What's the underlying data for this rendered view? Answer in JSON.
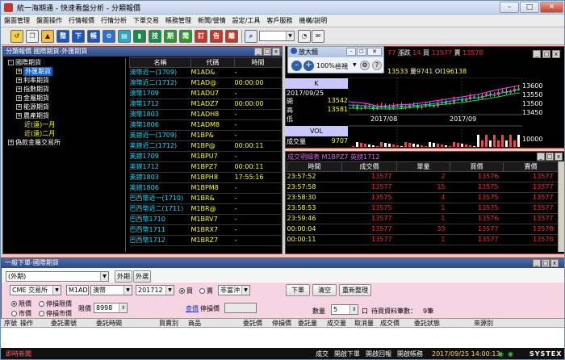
{
  "window": {
    "title": "統一海期通 - 快速看盤分析 - 分類報價"
  },
  "menu": [
    "盤面管理",
    "盤面操作",
    "行情報價",
    "行情分析",
    "下單交易",
    "帳務管理",
    "新聞/營情",
    "設定/工具",
    "客戶服務",
    "機構/說明"
  ],
  "toolbar_icons": [
    "key-icon",
    "new-icon",
    "chart-icon",
    "rise-icon",
    "arrow-down-icon",
    "ticker-icon",
    "gear-icon",
    "analysis-icon",
    "tech-icon",
    "period-icon",
    "news-icon",
    "order-icon",
    "announce-icon",
    "alert-icon",
    "search-icon",
    "chat-icon",
    "message-icon"
  ],
  "toolbar_text": {
    "b1": "整",
    "b2": "下",
    "b3": "帳",
    "b4": "技",
    "b5": "期",
    "b6": "聞",
    "b7": "訂",
    "b8": "告",
    "b9": "離"
  },
  "classpanel": {
    "title": "分類報價 國際期貨-外匯期貨",
    "tree": [
      {
        "label": "國際期貨",
        "level": 0,
        "open": true
      },
      {
        "label": "外匯期貨",
        "level": 1,
        "selected": true
      },
      {
        "label": "利率期貨",
        "level": 1
      },
      {
        "label": "指數期貨",
        "level": 1
      },
      {
        "label": "金屬期貨",
        "level": 1
      },
      {
        "label": "能源期貨",
        "level": 1
      },
      {
        "label": "農產期貨",
        "level": 1
      },
      {
        "label": "近(遠)一月",
        "level": 2
      },
      {
        "label": "近(遠)二月",
        "level": 2
      },
      {
        "label": "偽款金屬交易所",
        "level": 0
      }
    ],
    "columns": [
      "名稱",
      "代碼",
      "時間"
    ],
    "rows": [
      [
        "澳幣近一(1709)",
        "M1AD&",
        "-"
      ],
      [
        "澳幣近二(1712)",
        "M1AD@",
        "00:00:00"
      ],
      [
        "澳幣1709",
        "M1ADU7",
        "-"
      ],
      [
        "澳幣1712",
        "M1ADZ7",
        "00:00:00"
      ],
      [
        "澳幣1803",
        "M1ADH8",
        "-"
      ],
      [
        "澳幣1806",
        "M1ADM8",
        "-"
      ],
      [
        "英鎊近一(1709)",
        "M1BP&",
        "-"
      ],
      [
        "英鎊近二(1712)",
        "M1BP@",
        "00:00:11"
      ],
      [
        "英鎊1709",
        "M1BPU7",
        "-"
      ],
      [
        "英鎊1712",
        "M1BPZ7",
        "00:00:11"
      ],
      [
        "英鎊1803",
        "M1BPH8",
        "17:55:16"
      ],
      [
        "英鎊1806",
        "M1BPM8",
        "-"
      ],
      [
        "巴西幣近一(1710)",
        "M1BR&",
        "-"
      ],
      [
        "巴西幣近二(1711)",
        "M1BR@",
        "-"
      ],
      [
        "巴西幣1710",
        "M1BRV7",
        "-"
      ],
      [
        "巴西幣1711",
        "M1BRX7",
        "-"
      ],
      [
        "巴西幣1712",
        "M1BRZ7",
        "-"
      ]
    ]
  },
  "chart": {
    "quote": {
      "price": "77",
      "chg_label": "漲跌",
      "chg": "14",
      "buy_label": "買",
      "buy": "13577",
      "sell_label": "賣",
      "sell": "13578",
      "line2_a": "13533",
      "vol_label": "量",
      "vol": "9741",
      "oi_label": "OI",
      "oi": "196138"
    },
    "zoom": {
      "title": "放大鏡",
      "percent": "100%",
      "mode": "檢視"
    },
    "k_label": "K",
    "date": "2017/09/25",
    "rows": [
      {
        "label": "開",
        "value": "13542"
      },
      {
        "label": "高",
        "value": "13581"
      },
      {
        "label": "低",
        "value": ""
      }
    ],
    "vol_label": "VOL",
    "vol_row": {
      "label": "成交量",
      "value": "9707"
    },
    "axis": [
      "13600",
      "13550",
      "13500",
      "13450"
    ],
    "vol_axis": "10000",
    "dates": [
      "2017/08",
      "2017/09"
    ]
  },
  "trades": {
    "title": "成交明細表 M1BPZ7 英鎊1712",
    "columns": [
      "時間",
      "成交價",
      "單量",
      "買價",
      "賣價"
    ],
    "rows": [
      [
        "23:57:52",
        "13577",
        "2",
        "13576",
        "13577"
      ],
      [
        "23:57:58",
        "13577",
        "15",
        "13575",
        "13577"
      ],
      [
        "23:58:30",
        "13575",
        "4",
        "13575",
        "13577"
      ],
      [
        "23:58:53",
        "13575",
        "1",
        "13575",
        "13577"
      ],
      [
        "23:59:46",
        "13577",
        "1",
        "13576",
        "13577"
      ],
      [
        "00:00:04",
        "13577",
        "33",
        "13577",
        "13578"
      ],
      [
        "00:00:11",
        "13577",
        "1",
        "13577",
        "13578"
      ]
    ]
  },
  "order": {
    "title": "一般下單-國際期貨",
    "account_placeholder": "(外期)",
    "tab_foreign": "外期",
    "tab_outer": "外選",
    "exchange": "CME 交易所",
    "symbol": "M1AD",
    "symbol_name": "澳幣",
    "month": "201712",
    "buy_label": "買",
    "sell_label": "賣",
    "offset": "非當沖",
    "btn_order": "下單",
    "btn_clear": "清空",
    "btn_reset": "重新整理",
    "type_limit": "限價",
    "type_stoplimit": "停損限價",
    "type_market": "市價",
    "type_stopmarket": "停損市價",
    "price_label": "限價",
    "price": "8998",
    "query_link": "查價",
    "stop_label": "停損價",
    "qty_label": "數量",
    "qty": "5",
    "lots_unit": "口",
    "pending_label": "待買資料筆數：",
    "pending_value": "9筆",
    "columns": [
      "序號",
      "操作",
      "委託書號",
      "委託時間",
      "買賣別",
      "商品",
      "委託價",
      "停損價",
      "委託量",
      "成交量",
      "取消量",
      "成交價",
      "委託狀態",
      "來源別"
    ]
  },
  "status": {
    "news": "即時新聞",
    "items": [
      "成交",
      "開啟下單",
      "開啟回報",
      "開啟帳務"
    ],
    "datetime": "2017/09/25 14:00:13",
    "brand": "SYSTEX"
  }
}
